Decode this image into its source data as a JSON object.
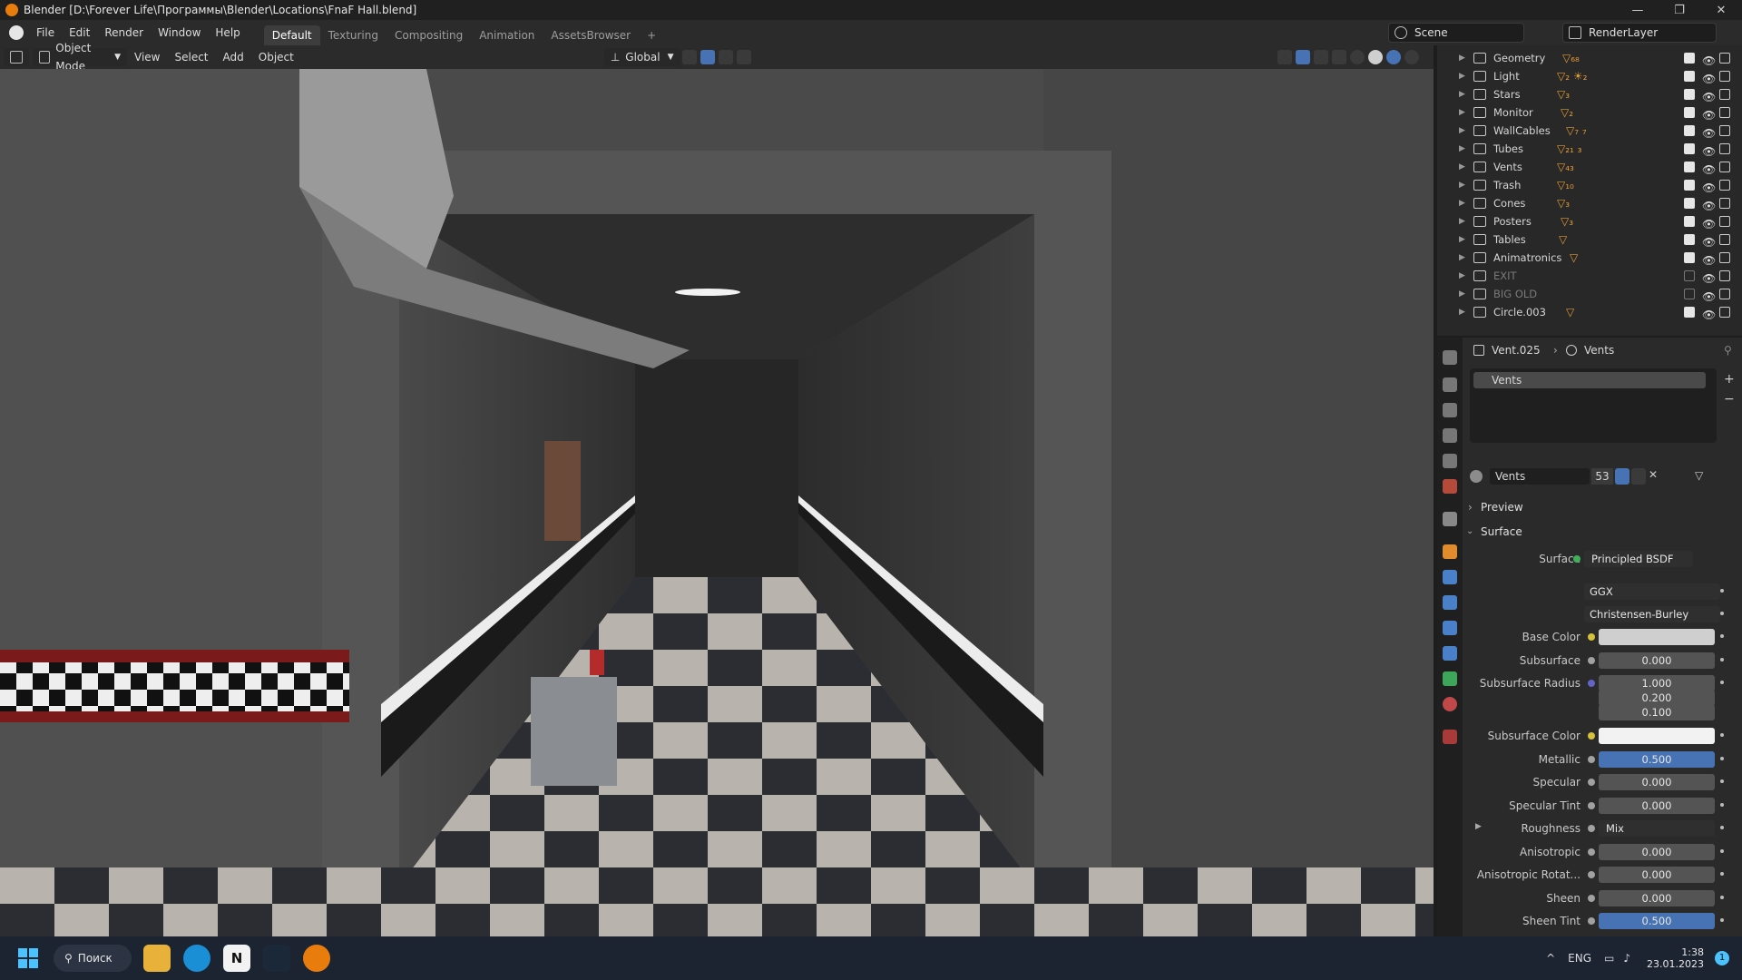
{
  "window": {
    "title": "Blender [D:\\Forever Life\\Программы\\Blender\\Locations\\FnaF Hall.blend]",
    "controls": [
      "—",
      "❐",
      "✕"
    ]
  },
  "menus": [
    "File",
    "Edit",
    "Render",
    "Window",
    "Help"
  ],
  "workspaces": [
    "Default",
    "Texturing",
    "Compositing",
    "Animation",
    "AssetsBrowser",
    "+"
  ],
  "scene": {
    "scene_name": "Scene",
    "render_layer": "RenderLayer"
  },
  "viewport_header": {
    "mode": "Object Mode",
    "items": [
      "View",
      "Select",
      "Add",
      "Object"
    ],
    "orientation": "Global"
  },
  "outliner": {
    "rows": [
      {
        "name": "Geometry",
        "badge": "▽₆₈",
        "enabled": true
      },
      {
        "name": "Light",
        "badge": "▽₂ ☀₂",
        "enabled": true
      },
      {
        "name": "Stars",
        "badge": "▽₃",
        "enabled": true
      },
      {
        "name": "Monitor",
        "badge": "▽₂",
        "enabled": true
      },
      {
        "name": "WallCables",
        "badge": "▽₇ ₇",
        "enabled": true
      },
      {
        "name": "Tubes",
        "badge": "▽₂₁ ₃",
        "enabled": true
      },
      {
        "name": "Vents",
        "badge": "▽₄₃",
        "enabled": true
      },
      {
        "name": "Trash",
        "badge": "▽₁₀",
        "enabled": true
      },
      {
        "name": "Cones",
        "badge": "▽₃",
        "enabled": true
      },
      {
        "name": "Posters",
        "badge": "▽₃",
        "enabled": true
      },
      {
        "name": "Tables",
        "badge": "▽",
        "enabled": true
      },
      {
        "name": "Animatronics",
        "badge": "▽",
        "enabled": true
      },
      {
        "name": "EXIT",
        "badge": "",
        "enabled": false
      },
      {
        "name": "BIG OLD",
        "badge": "",
        "enabled": false
      },
      {
        "name": "Circle.003",
        "badge": "▽",
        "enabled": true
      }
    ]
  },
  "properties": {
    "breadcrumb_object": "Vent.025",
    "breadcrumb_material": "Vents",
    "slot_name": "Vents",
    "material_name": "Vents",
    "material_users": "53",
    "panels": {
      "preview": "Preview",
      "surface": "Surface"
    },
    "surface_shader_label": "Surface",
    "surface_shader": "Principled BSDF",
    "distribution": "GGX",
    "subsurface_method": "Christensen-Burley",
    "fields": [
      {
        "label": "Base Color",
        "value": "",
        "kind": "color",
        "dot": "#d6c23a"
      },
      {
        "label": "Subsurface",
        "value": "0.000",
        "kind": "num",
        "dot": "#a1a1a1"
      },
      {
        "label": "Subsurface Radius",
        "value": "1.000",
        "kind": "num",
        "dot": "#6363c7"
      },
      {
        "label": "",
        "value": "0.200",
        "kind": "num",
        "dot": ""
      },
      {
        "label": "",
        "value": "0.100",
        "kind": "num",
        "dot": ""
      },
      {
        "label": "Subsurface Color",
        "value": "",
        "kind": "color-white",
        "dot": "#d6c23a"
      },
      {
        "label": "Metallic",
        "value": "0.500",
        "kind": "blue",
        "dot": "#a1a1a1"
      },
      {
        "label": "Specular",
        "value": "0.000",
        "kind": "num",
        "dot": "#a1a1a1"
      },
      {
        "label": "Specular Tint",
        "value": "0.000",
        "kind": "num",
        "dot": "#a1a1a1"
      },
      {
        "label": "Roughness",
        "value": "Mix",
        "kind": "dark",
        "dot": "#a1a1a1"
      },
      {
        "label": "Anisotropic",
        "value": "0.000",
        "kind": "num",
        "dot": "#a1a1a1"
      },
      {
        "label": "Anisotropic Rotat...",
        "value": "0.000",
        "kind": "num",
        "dot": "#a1a1a1"
      },
      {
        "label": "Sheen",
        "value": "0.000",
        "kind": "num",
        "dot": "#a1a1a1"
      },
      {
        "label": "Sheen Tint",
        "value": "0.500",
        "kind": "blue",
        "dot": "#a1a1a1"
      }
    ]
  },
  "taskbar": {
    "search": "Поиск",
    "lang": "ENG",
    "time": "1:38",
    "date": "23.01.2023",
    "notifications": "1"
  }
}
